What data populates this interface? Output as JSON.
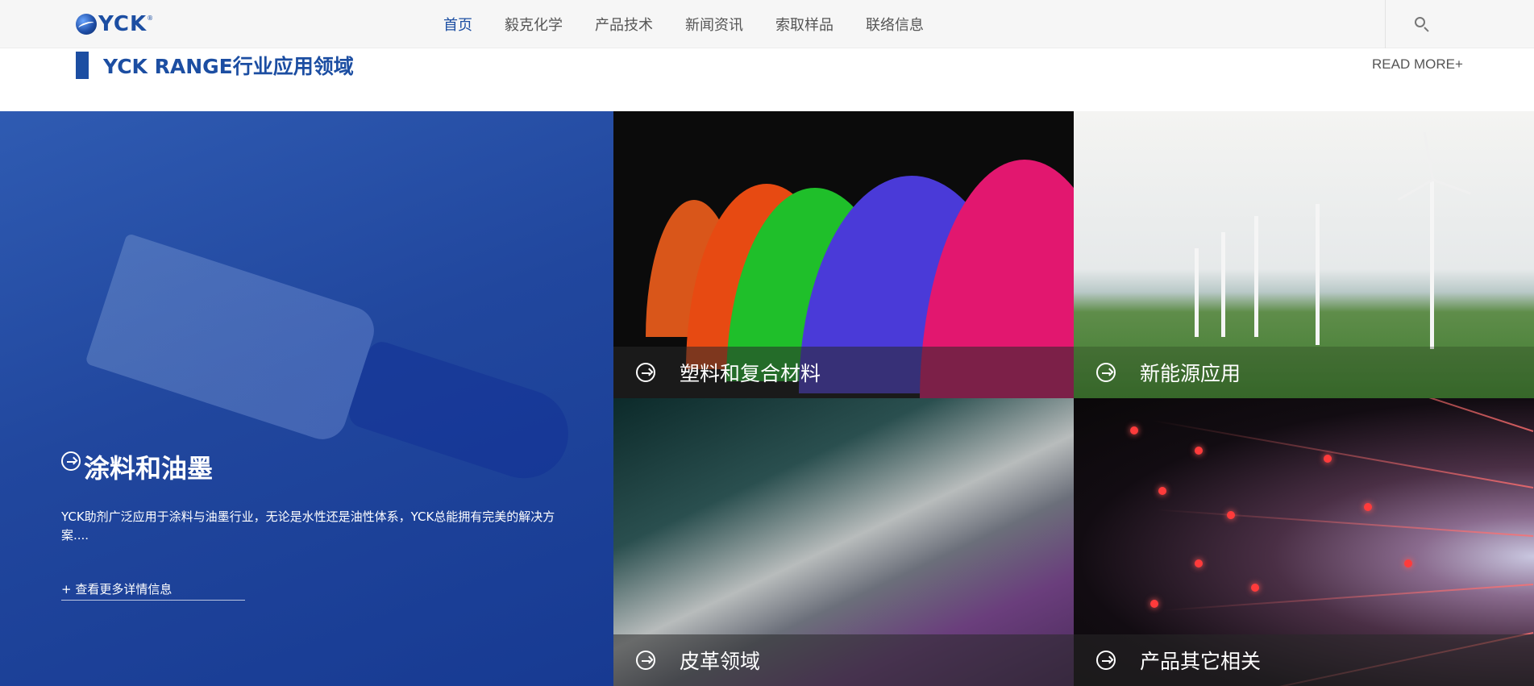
{
  "brand": {
    "logo_text": "YCK",
    "reg_mark": "®"
  },
  "nav": {
    "items": [
      {
        "label": "首页",
        "active": true
      },
      {
        "label": "毅克化学",
        "active": false
      },
      {
        "label": "产品技术",
        "active": false
      },
      {
        "label": "新闻资讯",
        "active": false
      },
      {
        "label": "索取样品",
        "active": false
      },
      {
        "label": "联络信息",
        "active": false
      }
    ],
    "search_icon": "search-icon"
  },
  "section": {
    "title": "YCK RANGE行业应用领域",
    "read_more": "READ MORE+"
  },
  "main_tile": {
    "title": "涂料和油墨",
    "description": "YCK助剂广泛应用于涂料与油墨行业，无论是水性还是油性体系，YCK总能拥有完美的解决方案....",
    "link": "+ 查看更多详情信息"
  },
  "tiles": [
    {
      "label": "塑料和复合材料",
      "icon": "arrow-circle-icon"
    },
    {
      "label": "新能源应用",
      "icon": "arrow-circle-icon"
    },
    {
      "label": "皮革领域",
      "icon": "arrow-circle-icon"
    },
    {
      "label": "产品其它相关",
      "icon": "arrow-circle-icon"
    }
  ],
  "colors": {
    "brand_blue": "#1c4ea2",
    "nav_text": "#555555",
    "topbar_bg": "#f6f6f6"
  }
}
